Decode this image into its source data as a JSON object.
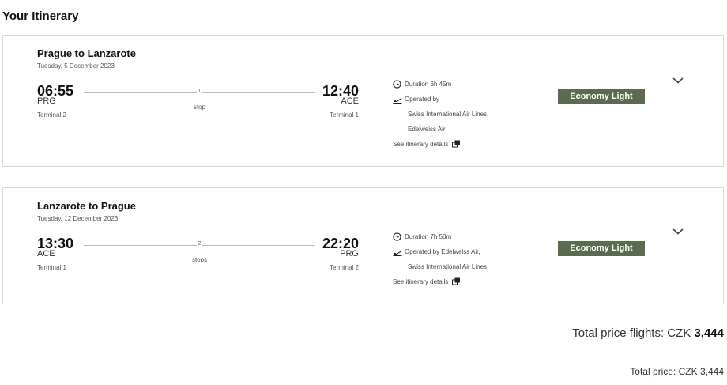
{
  "page": {
    "title": "Your Itinerary"
  },
  "flights": [
    {
      "route": "Prague to Lanzarote",
      "date": "Tuesday, 5 December 2023",
      "departure": {
        "time": "06:55",
        "code": "PRG",
        "terminal": "Terminal 2"
      },
      "arrival": {
        "time": "12:40",
        "code": "ACE",
        "terminal": "Terminal 1"
      },
      "stops_count": "1",
      "stops_label": "stop",
      "duration": "Duration  6h 45m",
      "operated_by_label": "Operated by",
      "operators_line1": "Swiss International Air Lines,",
      "operators_line2": "Edelweiss Air",
      "details_link": "See itinerary details",
      "fare": "Economy Light"
    },
    {
      "route": "Lanzarote to Prague",
      "date": "Tuesday, 12 December 2023",
      "departure": {
        "time": "13:30",
        "code": "ACE",
        "terminal": "Terminal 1"
      },
      "arrival": {
        "time": "22:20",
        "code": "PRG",
        "terminal": "Terminal 2"
      },
      "stops_count": "2",
      "stops_label": "stops",
      "duration": "Duration  7h 50m",
      "operated_by_label": "Operated by  Edelweiss Air,",
      "operators_line1": "Swiss International Air Lines",
      "details_link": "See itinerary details",
      "fare": "Economy Light"
    }
  ],
  "totals": {
    "flights_label": "Total price flights: CZK ",
    "flights_amount": "3,444",
    "total_label": "Total price:  CZK 3,444"
  },
  "colors": {
    "fare_badge": "#5a6b4f",
    "border": "#d7d7d7"
  },
  "icons": [
    "clock-icon",
    "plane-takeoff-icon",
    "external-link-icon",
    "chevron-down-icon"
  ]
}
